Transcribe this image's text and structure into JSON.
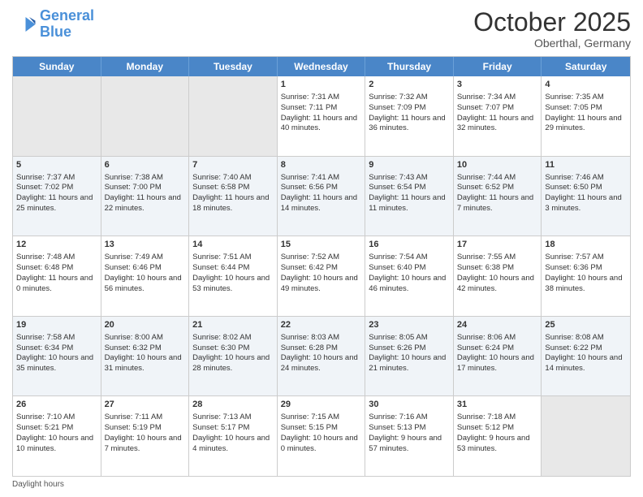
{
  "header": {
    "logo_line1": "General",
    "logo_line2": "Blue",
    "month": "October 2025",
    "location": "Oberthal, Germany"
  },
  "days_of_week": [
    "Sunday",
    "Monday",
    "Tuesday",
    "Wednesday",
    "Thursday",
    "Friday",
    "Saturday"
  ],
  "weeks": [
    [
      {
        "day": "",
        "sunrise": "",
        "sunset": "",
        "daylight": "",
        "empty": true
      },
      {
        "day": "",
        "sunrise": "",
        "sunset": "",
        "daylight": "",
        "empty": true
      },
      {
        "day": "",
        "sunrise": "",
        "sunset": "",
        "daylight": "",
        "empty": true
      },
      {
        "day": "1",
        "sunrise": "Sunrise: 7:31 AM",
        "sunset": "Sunset: 7:11 PM",
        "daylight": "Daylight: 11 hours and 40 minutes."
      },
      {
        "day": "2",
        "sunrise": "Sunrise: 7:32 AM",
        "sunset": "Sunset: 7:09 PM",
        "daylight": "Daylight: 11 hours and 36 minutes."
      },
      {
        "day": "3",
        "sunrise": "Sunrise: 7:34 AM",
        "sunset": "Sunset: 7:07 PM",
        "daylight": "Daylight: 11 hours and 32 minutes."
      },
      {
        "day": "4",
        "sunrise": "Sunrise: 7:35 AM",
        "sunset": "Sunset: 7:05 PM",
        "daylight": "Daylight: 11 hours and 29 minutes."
      }
    ],
    [
      {
        "day": "5",
        "sunrise": "Sunrise: 7:37 AM",
        "sunset": "Sunset: 7:02 PM",
        "daylight": "Daylight: 11 hours and 25 minutes."
      },
      {
        "day": "6",
        "sunrise": "Sunrise: 7:38 AM",
        "sunset": "Sunset: 7:00 PM",
        "daylight": "Daylight: 11 hours and 22 minutes."
      },
      {
        "day": "7",
        "sunrise": "Sunrise: 7:40 AM",
        "sunset": "Sunset: 6:58 PM",
        "daylight": "Daylight: 11 hours and 18 minutes."
      },
      {
        "day": "8",
        "sunrise": "Sunrise: 7:41 AM",
        "sunset": "Sunset: 6:56 PM",
        "daylight": "Daylight: 11 hours and 14 minutes."
      },
      {
        "day": "9",
        "sunrise": "Sunrise: 7:43 AM",
        "sunset": "Sunset: 6:54 PM",
        "daylight": "Daylight: 11 hours and 11 minutes."
      },
      {
        "day": "10",
        "sunrise": "Sunrise: 7:44 AM",
        "sunset": "Sunset: 6:52 PM",
        "daylight": "Daylight: 11 hours and 7 minutes."
      },
      {
        "day": "11",
        "sunrise": "Sunrise: 7:46 AM",
        "sunset": "Sunset: 6:50 PM",
        "daylight": "Daylight: 11 hours and 3 minutes."
      }
    ],
    [
      {
        "day": "12",
        "sunrise": "Sunrise: 7:48 AM",
        "sunset": "Sunset: 6:48 PM",
        "daylight": "Daylight: 11 hours and 0 minutes."
      },
      {
        "day": "13",
        "sunrise": "Sunrise: 7:49 AM",
        "sunset": "Sunset: 6:46 PM",
        "daylight": "Daylight: 10 hours and 56 minutes."
      },
      {
        "day": "14",
        "sunrise": "Sunrise: 7:51 AM",
        "sunset": "Sunset: 6:44 PM",
        "daylight": "Daylight: 10 hours and 53 minutes."
      },
      {
        "day": "15",
        "sunrise": "Sunrise: 7:52 AM",
        "sunset": "Sunset: 6:42 PM",
        "daylight": "Daylight: 10 hours and 49 minutes."
      },
      {
        "day": "16",
        "sunrise": "Sunrise: 7:54 AM",
        "sunset": "Sunset: 6:40 PM",
        "daylight": "Daylight: 10 hours and 46 minutes."
      },
      {
        "day": "17",
        "sunrise": "Sunrise: 7:55 AM",
        "sunset": "Sunset: 6:38 PM",
        "daylight": "Daylight: 10 hours and 42 minutes."
      },
      {
        "day": "18",
        "sunrise": "Sunrise: 7:57 AM",
        "sunset": "Sunset: 6:36 PM",
        "daylight": "Daylight: 10 hours and 38 minutes."
      }
    ],
    [
      {
        "day": "19",
        "sunrise": "Sunrise: 7:58 AM",
        "sunset": "Sunset: 6:34 PM",
        "daylight": "Daylight: 10 hours and 35 minutes."
      },
      {
        "day": "20",
        "sunrise": "Sunrise: 8:00 AM",
        "sunset": "Sunset: 6:32 PM",
        "daylight": "Daylight: 10 hours and 31 minutes."
      },
      {
        "day": "21",
        "sunrise": "Sunrise: 8:02 AM",
        "sunset": "Sunset: 6:30 PM",
        "daylight": "Daylight: 10 hours and 28 minutes."
      },
      {
        "day": "22",
        "sunrise": "Sunrise: 8:03 AM",
        "sunset": "Sunset: 6:28 PM",
        "daylight": "Daylight: 10 hours and 24 minutes."
      },
      {
        "day": "23",
        "sunrise": "Sunrise: 8:05 AM",
        "sunset": "Sunset: 6:26 PM",
        "daylight": "Daylight: 10 hours and 21 minutes."
      },
      {
        "day": "24",
        "sunrise": "Sunrise: 8:06 AM",
        "sunset": "Sunset: 6:24 PM",
        "daylight": "Daylight: 10 hours and 17 minutes."
      },
      {
        "day": "25",
        "sunrise": "Sunrise: 8:08 AM",
        "sunset": "Sunset: 6:22 PM",
        "daylight": "Daylight: 10 hours and 14 minutes."
      }
    ],
    [
      {
        "day": "26",
        "sunrise": "Sunrise: 7:10 AM",
        "sunset": "Sunset: 5:21 PM",
        "daylight": "Daylight: 10 hours and 10 minutes."
      },
      {
        "day": "27",
        "sunrise": "Sunrise: 7:11 AM",
        "sunset": "Sunset: 5:19 PM",
        "daylight": "Daylight: 10 hours and 7 minutes."
      },
      {
        "day": "28",
        "sunrise": "Sunrise: 7:13 AM",
        "sunset": "Sunset: 5:17 PM",
        "daylight": "Daylight: 10 hours and 4 minutes."
      },
      {
        "day": "29",
        "sunrise": "Sunrise: 7:15 AM",
        "sunset": "Sunset: 5:15 PM",
        "daylight": "Daylight: 10 hours and 0 minutes."
      },
      {
        "day": "30",
        "sunrise": "Sunrise: 7:16 AM",
        "sunset": "Sunset: 5:13 PM",
        "daylight": "Daylight: 9 hours and 57 minutes."
      },
      {
        "day": "31",
        "sunrise": "Sunrise: 7:18 AM",
        "sunset": "Sunset: 5:12 PM",
        "daylight": "Daylight: 9 hours and 53 minutes."
      },
      {
        "day": "",
        "sunrise": "",
        "sunset": "",
        "daylight": "",
        "empty": true
      }
    ]
  ],
  "footer": {
    "note": "Daylight hours"
  }
}
